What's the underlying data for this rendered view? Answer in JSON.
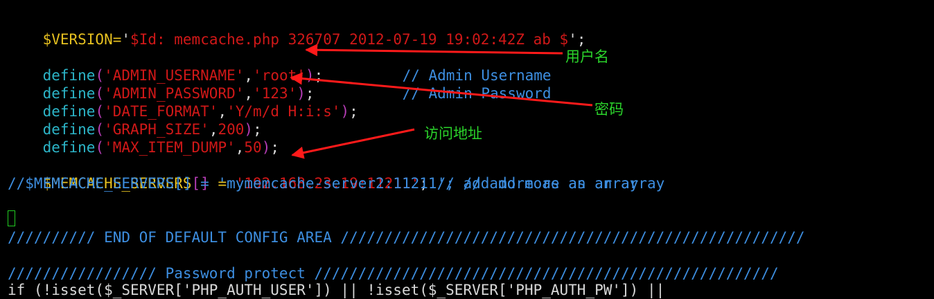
{
  "colors": {
    "background": "#000000",
    "variable": "#e6c020",
    "function": "#2cb5c8",
    "string": "#d01818",
    "paren": "#b63db6",
    "punct": "#d8d8d8",
    "comment": "#3d8ee0",
    "cursor": "#22cc22",
    "annotation": "#2bd42b",
    "arrow": "#ff1a1a"
  },
  "code": {
    "version_line": [
      "$VERSION",
      "=",
      "'",
      "$Id: memcache.php 326707 2012-07-19 19:02:42Z ab $",
      "'",
      ";"
    ],
    "define_username": [
      "define",
      "(",
      "'ADMIN_USERNAME'",
      ",",
      "'root'",
      ")",
      ";",
      "// Admin Username"
    ],
    "define_password": [
      "define",
      "(",
      "'ADMIN_PASSWORD'",
      ",",
      "'123'",
      ")",
      ";",
      "// Admin Password"
    ],
    "define_date": [
      "define",
      "(",
      "'DATE_FORMAT'",
      ",",
      "'Y/m/d H:i:s'",
      ")",
      ";"
    ],
    "define_graph": [
      "define",
      "(",
      "'GRAPH_SIZE'",
      ",",
      "200",
      ")",
      ";"
    ],
    "define_maxdump": [
      "define",
      "(",
      "'MAX_ITEM_DUMP'",
      ",",
      "50",
      ")",
      ";"
    ],
    "servers_line": [
      "$MEMCACHE_SERVERS",
      "[]",
      " = ",
      "'192.168.23.19:11211'",
      "; ",
      "// add more as an array"
    ],
    "servers_comment": "//$MEMCACHE_SERVERS[] = 'mymemcache-server2:11211'; // add more as an array",
    "end_config": "////////// END OF DEFAULT CONFIG AREA /////////////////////////////////////////////////////",
    "password_protect": "///////////////// Password protect /////////////////////////////////////////////////////",
    "partial_line": "if (!isset($_SERVER['PHP_AUTH_USER']) || !isset($_SERVER['PHP_AUTH_PW']) ||"
  },
  "annotations": {
    "username": "用户名",
    "password": "密码",
    "address": "访问地址"
  }
}
